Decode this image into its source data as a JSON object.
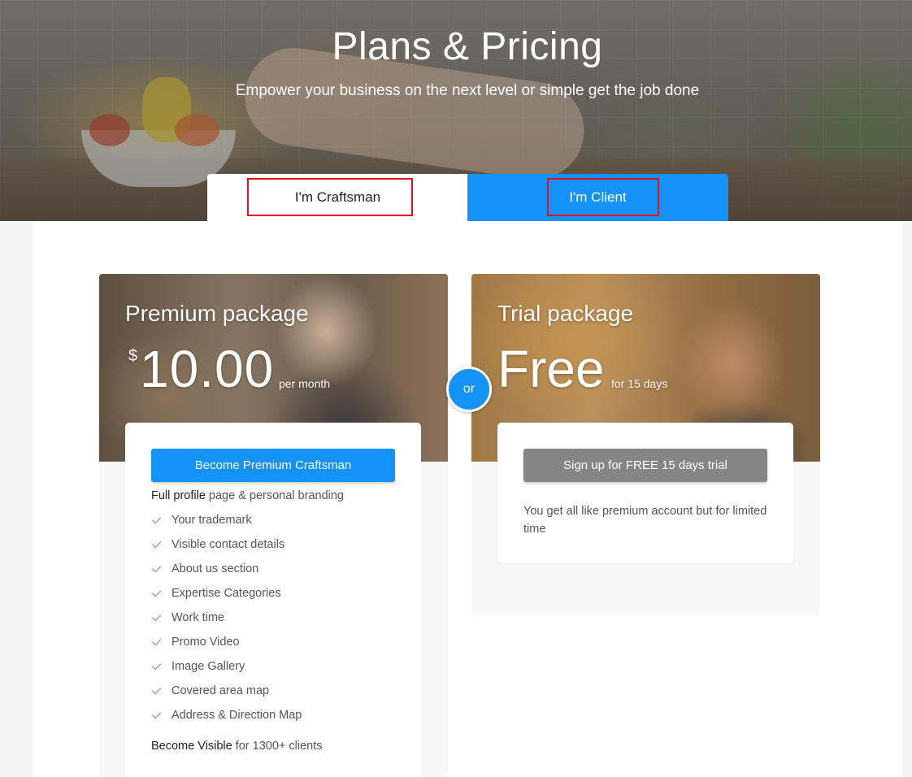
{
  "hero": {
    "title": "Plans & Pricing",
    "subtitle": "Empower your business on the next level or simple get the job done"
  },
  "tabs": [
    {
      "label": "I'm Craftsman",
      "active": true
    },
    {
      "label": "I'm Client",
      "active": false
    }
  ],
  "premium": {
    "title": "Premium package",
    "currency": "$",
    "price": "10.00",
    "period": "per month",
    "cta": "Become Premium Craftsman",
    "feature_heading_bold": "Full profile",
    "feature_heading_rest": " page & personal branding",
    "features": [
      "Your trademark",
      "Visible contact details",
      "About us section",
      "Expertise Categories",
      "Work time",
      "Promo Video",
      "Image Gallery",
      "Covered area map",
      "Address & Direction Map"
    ],
    "footer_bold": "Become Visible",
    "footer_rest": " for 1300+ clients"
  },
  "separator": "or",
  "trial": {
    "title": "Trial package",
    "price": "Free",
    "period": "for 15 days",
    "cta": "Sign up for FREE 15 days trial",
    "description": "You get all like premium account but for limited time"
  },
  "colors": {
    "accent": "#1592f5",
    "check": "#4caa55",
    "highlight": "#e1121e",
    "trial_button": "#858585"
  }
}
